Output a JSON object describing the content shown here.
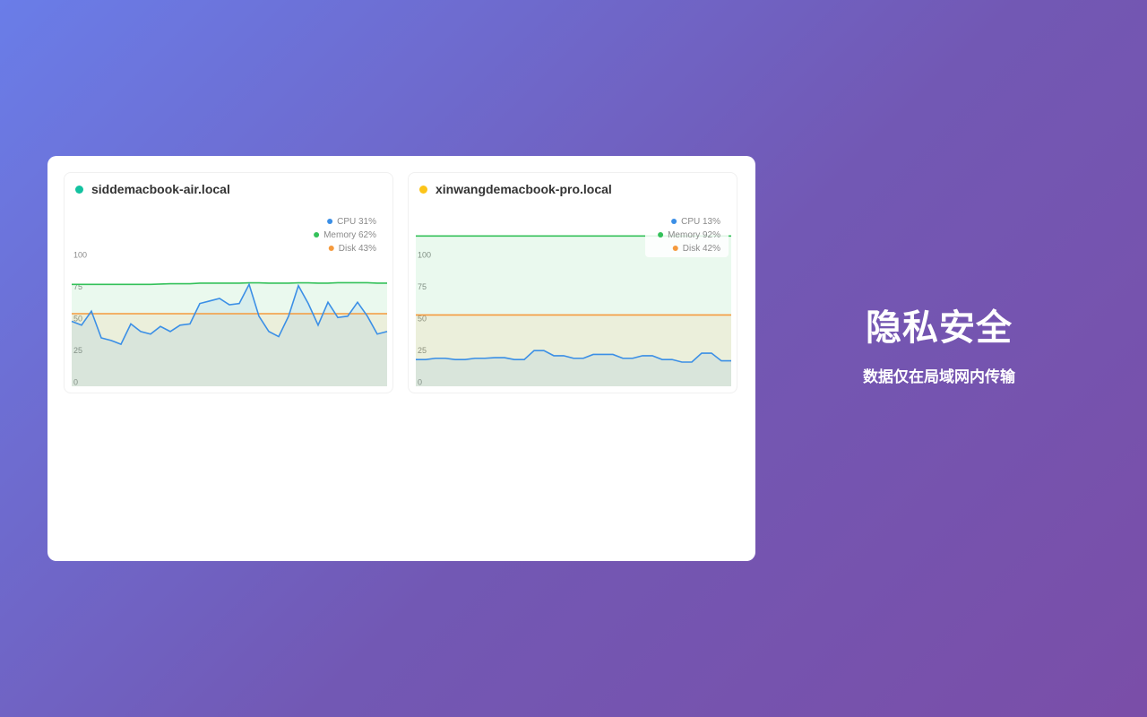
{
  "colors": {
    "cpu": "#3b8fe6",
    "memory": "#34c15a",
    "disk": "#f59a3d",
    "status_online": "#13c2a0",
    "status_warning": "#fcc419"
  },
  "tagline": {
    "title": "隐私安全",
    "subtitle": "数据仅在局域网内传输"
  },
  "devices": [
    {
      "name": "siddemacbook-air.local",
      "status_color": "#13c2a0",
      "legend": {
        "cpu": "CPU 31%",
        "memory": "Memory 62%",
        "disk": "Disk 43%"
      }
    },
    {
      "name": "xinwangdemacbook-pro.local",
      "status_color": "#fcc419",
      "legend": {
        "cpu": "CPU 13%",
        "memory": "Memory 92%",
        "disk": "Disk 42%"
      }
    }
  ],
  "chart_data": [
    {
      "type": "area",
      "title": "siddemacbook-air.local",
      "ylim": [
        0,
        100
      ],
      "y_ticks": [
        "100",
        "75",
        "50",
        "25",
        "0"
      ],
      "legend_position": "top-right",
      "series": [
        {
          "name": "CPU 31%",
          "color": "#3b8fe6",
          "values": [
            48,
            45,
            56,
            35,
            33,
            30,
            46,
            40,
            38,
            44,
            40,
            45,
            46,
            62,
            64,
            66,
            61,
            62,
            77,
            52,
            40,
            36,
            52,
            76,
            62,
            45,
            63,
            51,
            52,
            63,
            52,
            38,
            40
          ]
        },
        {
          "name": "Memory 62%",
          "color": "#34c15a",
          "values": [
            77,
            77,
            77,
            77,
            77,
            77,
            77,
            77,
            77,
            77.3,
            77.5,
            77.5,
            77.5,
            78,
            78,
            78,
            78,
            78,
            78.2,
            78.2,
            78,
            78,
            78,
            78.2,
            78.2,
            78,
            78,
            78.3,
            78.3,
            78.3,
            78.3,
            78,
            78
          ]
        },
        {
          "name": "Disk 43%",
          "color": "#f59a3d",
          "values": [
            54,
            54,
            54,
            54,
            54,
            54,
            54,
            54,
            54,
            54,
            54,
            54,
            54,
            54,
            54,
            54,
            54,
            54,
            54,
            54,
            54,
            54,
            54,
            54,
            54,
            54,
            54,
            54,
            54,
            54,
            54,
            54,
            54
          ]
        }
      ]
    },
    {
      "type": "area",
      "title": "xinwangdemacbook-pro.local",
      "ylim": [
        0,
        100
      ],
      "y_ticks": [
        "100",
        "75",
        "50",
        "25",
        "0"
      ],
      "legend_position": "top-right",
      "series": [
        {
          "name": "CPU 13%",
          "color": "#3b8fe6",
          "values": [
            18,
            18,
            19,
            19,
            18,
            18,
            19,
            19,
            19.5,
            19.5,
            18,
            18,
            25,
            25,
            21,
            21,
            19,
            19,
            22,
            22,
            22,
            19,
            19,
            21,
            21,
            18,
            18,
            16,
            16,
            23,
            23,
            17,
            17
          ]
        },
        {
          "name": "Memory 92%",
          "color": "#34c15a",
          "values": [
            115,
            115,
            115,
            115,
            115,
            115,
            115,
            115,
            115,
            115,
            115,
            115,
            115,
            115,
            115,
            115,
            115,
            115,
            115,
            115,
            115,
            115,
            115,
            115,
            115,
            115,
            115,
            115,
            115,
            115,
            115,
            115,
            115
          ]
        },
        {
          "name": "Disk 42%",
          "color": "#f59a3d",
          "values": [
            53,
            53,
            53,
            53,
            53,
            53,
            53,
            53,
            53,
            53,
            53,
            53,
            53,
            53,
            53,
            53,
            53,
            53,
            53,
            53,
            53,
            53,
            53,
            53,
            53,
            53,
            53,
            53,
            53,
            53,
            53,
            53,
            53
          ]
        }
      ]
    }
  ]
}
